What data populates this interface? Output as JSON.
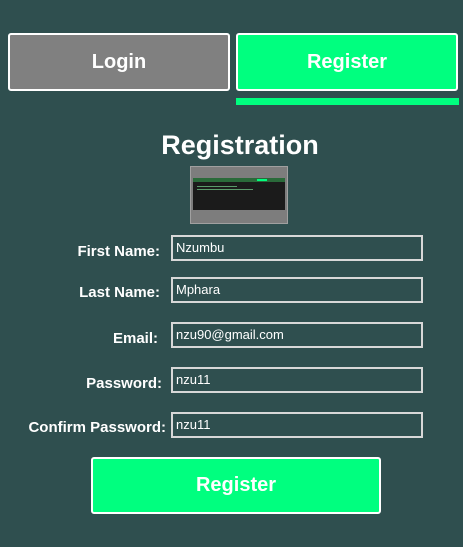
{
  "tabs": {
    "login_label": "Login",
    "register_label": "Register",
    "active": "Register"
  },
  "form": {
    "title": "Registration",
    "fields": [
      {
        "label": "First Name:",
        "value": "Nzumbu"
      },
      {
        "label": "Last Name:",
        "value": "Mphara"
      },
      {
        "label": "Email:",
        "value": "nzu90@gmail.com"
      },
      {
        "label": "Password:",
        "value": "nzu11"
      },
      {
        "label": "Confirm Password:",
        "value": "nzu11"
      }
    ],
    "submit_label": "Register"
  },
  "colors": {
    "background": "#2f4f4f",
    "accent": "#00ff7f",
    "inactive_tab": "#808080",
    "text": "#ffffff"
  }
}
